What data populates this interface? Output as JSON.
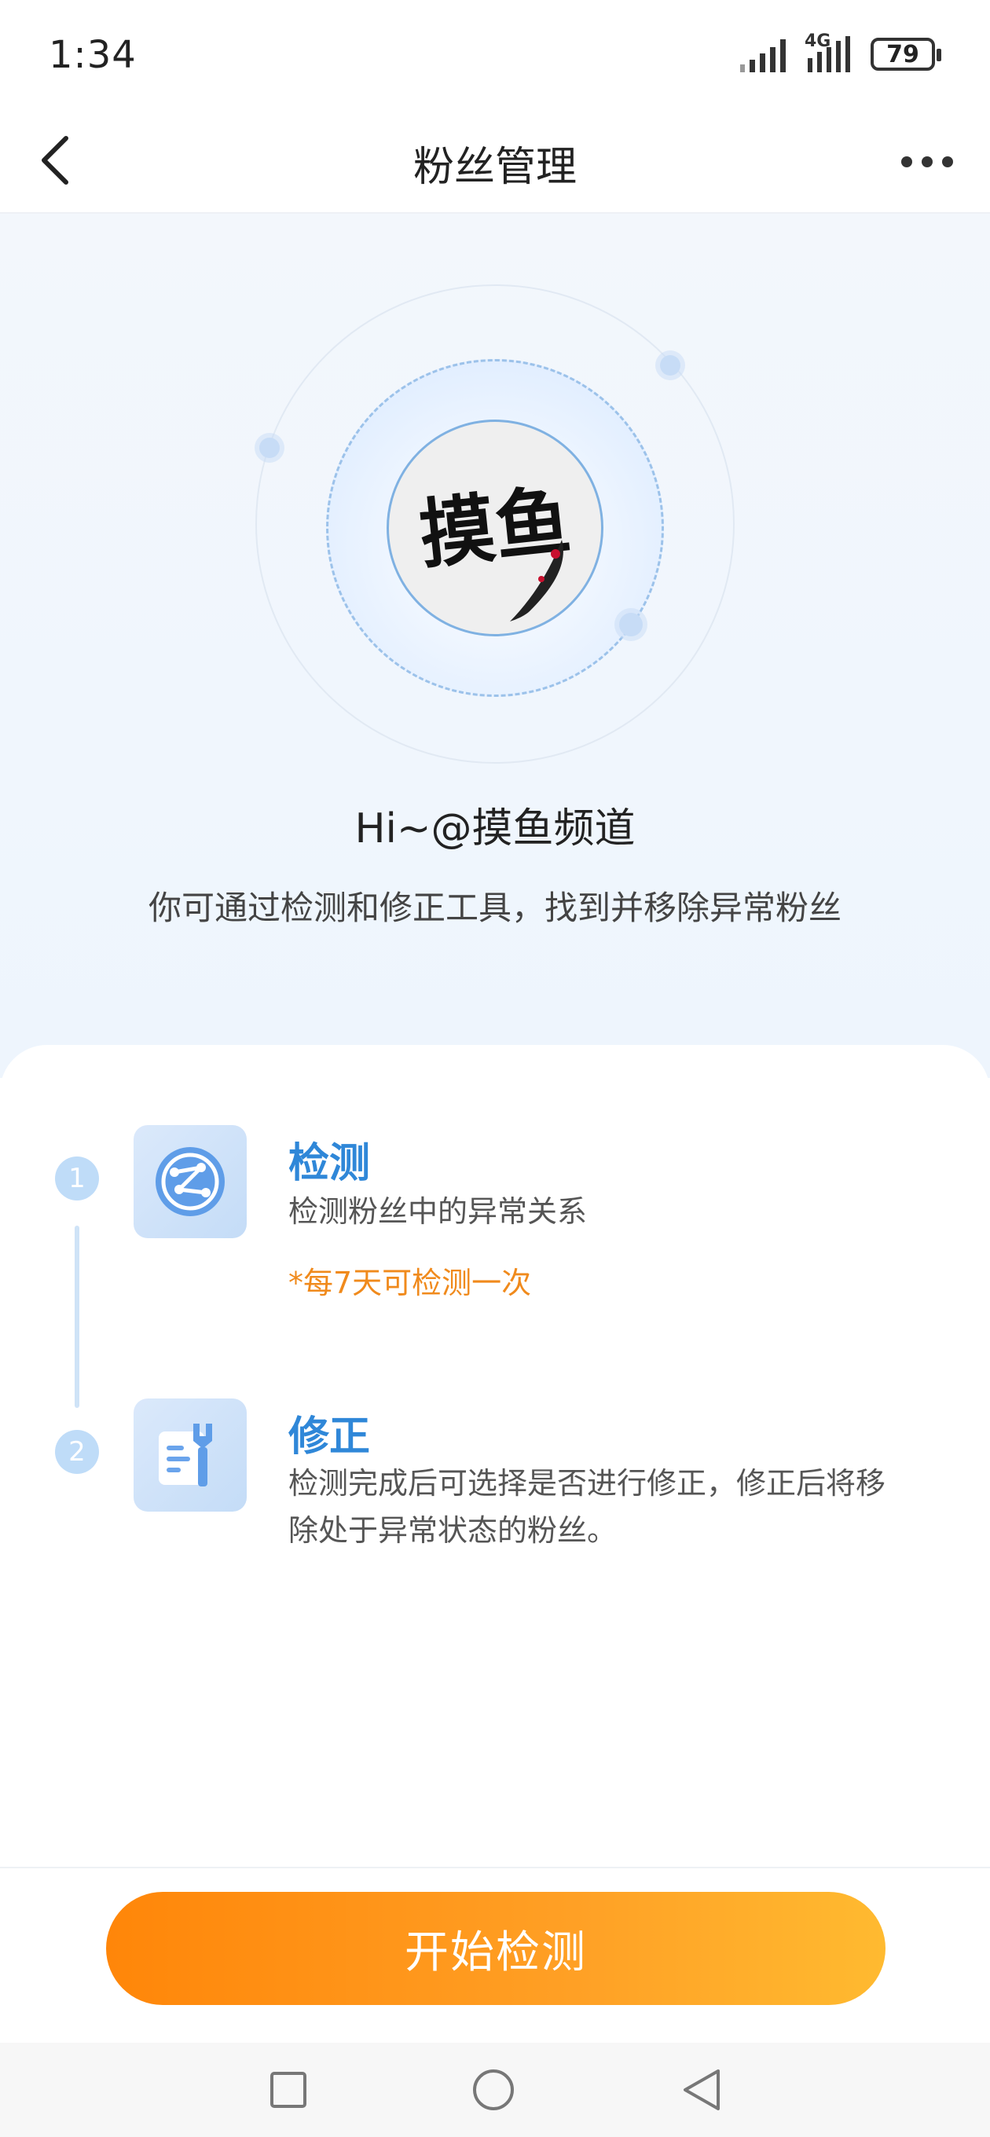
{
  "status_bar": {
    "time": "1:34",
    "network": "4G",
    "battery": "79"
  },
  "nav": {
    "title": "粉丝管理"
  },
  "hero": {
    "avatar_text": "摸鱼",
    "greeting": "Hi~@摸鱼频道",
    "description": "你可通过检测和修正工具，找到并移除异常粉丝"
  },
  "steps": [
    {
      "number": "1",
      "title": "检测",
      "description": "检测粉丝中的异常关系",
      "note": "*每7天可检测一次"
    },
    {
      "number": "2",
      "title": "修正",
      "description_line1": "检测完成后可选择是否进行修正，修正后将移",
      "description_line2": "除处于异常状态的粉丝。"
    }
  ],
  "actions": {
    "start_label": "开始检测"
  },
  "colors": {
    "accent_blue": "#2f87d8",
    "note_orange": "#f08a1c",
    "button_start": "#ff8609",
    "button_end": "#ffba30"
  }
}
